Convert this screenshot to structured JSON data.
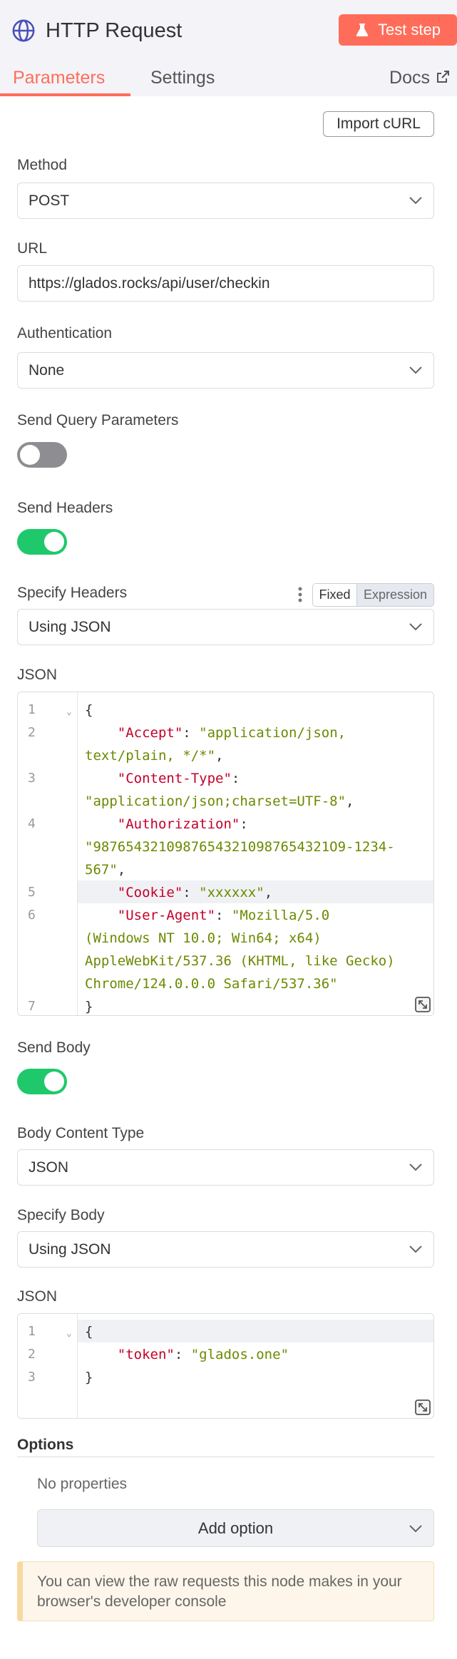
{
  "header": {
    "title": "HTTP Request",
    "test_button": "Test step",
    "accent": "#ff6d5a"
  },
  "tabs": {
    "parameters": "Parameters",
    "settings": "Settings",
    "docs": "Docs"
  },
  "import_curl": "Import cURL",
  "method": {
    "label": "Method",
    "value": "POST"
  },
  "url": {
    "label": "URL",
    "value": "https://glados.rocks/api/user/checkin"
  },
  "authentication": {
    "label": "Authentication",
    "value": "None"
  },
  "send_query": {
    "label": "Send Query Parameters",
    "enabled": false
  },
  "send_headers": {
    "label": "Send Headers",
    "enabled": true
  },
  "specify_headers": {
    "label": "Specify Headers",
    "value": "Using JSON",
    "mode_fixed": "Fixed",
    "mode_expression": "Expression"
  },
  "headers_json": {
    "label": "JSON",
    "line_numbers": [
      "1",
      "2",
      "3",
      "4",
      "5",
      "6",
      "7"
    ],
    "open_brace": "{",
    "close_brace": "}",
    "accept_key": "\"Accept\"",
    "accept_val_1": "\"application/json,",
    "accept_val_2": "text/plain, */*\"",
    "ctype_key": "\"Content-Type\"",
    "ctype_val": "\"application/json;charset=UTF-8\"",
    "auth_key": "\"Authorization\"",
    "auth_val_1": "\"98765432109876543210987654321O9-1234-",
    "auth_val_2": "567\"",
    "cookie_key": "\"Cookie\"",
    "cookie_val": "\"xxxxxx\"",
    "ua_key": "\"User-Agent\"",
    "ua_val_1": "\"Mozilla/5.0",
    "ua_val_2": "(Windows NT 10.0; Win64; x64)",
    "ua_val_3": "AppleWebKit/537.36 (KHTML, like Gecko)",
    "ua_val_4": "Chrome/124.0.0.0 Safari/537.36\""
  },
  "send_body": {
    "label": "Send Body",
    "enabled": true
  },
  "body_content_type": {
    "label": "Body Content Type",
    "value": "JSON"
  },
  "specify_body": {
    "label": "Specify Body",
    "value": "Using JSON"
  },
  "body_json": {
    "label": "JSON",
    "line_numbers": [
      "1",
      "2",
      "3"
    ],
    "open_brace": "{",
    "close_brace": "}",
    "token_key": "\"token\"",
    "token_val": "\"glados.one\""
  },
  "options": {
    "title": "Options",
    "empty": "No properties",
    "add_button": "Add option"
  },
  "notice": "You can view the raw requests this node makes in your browser's developer console"
}
